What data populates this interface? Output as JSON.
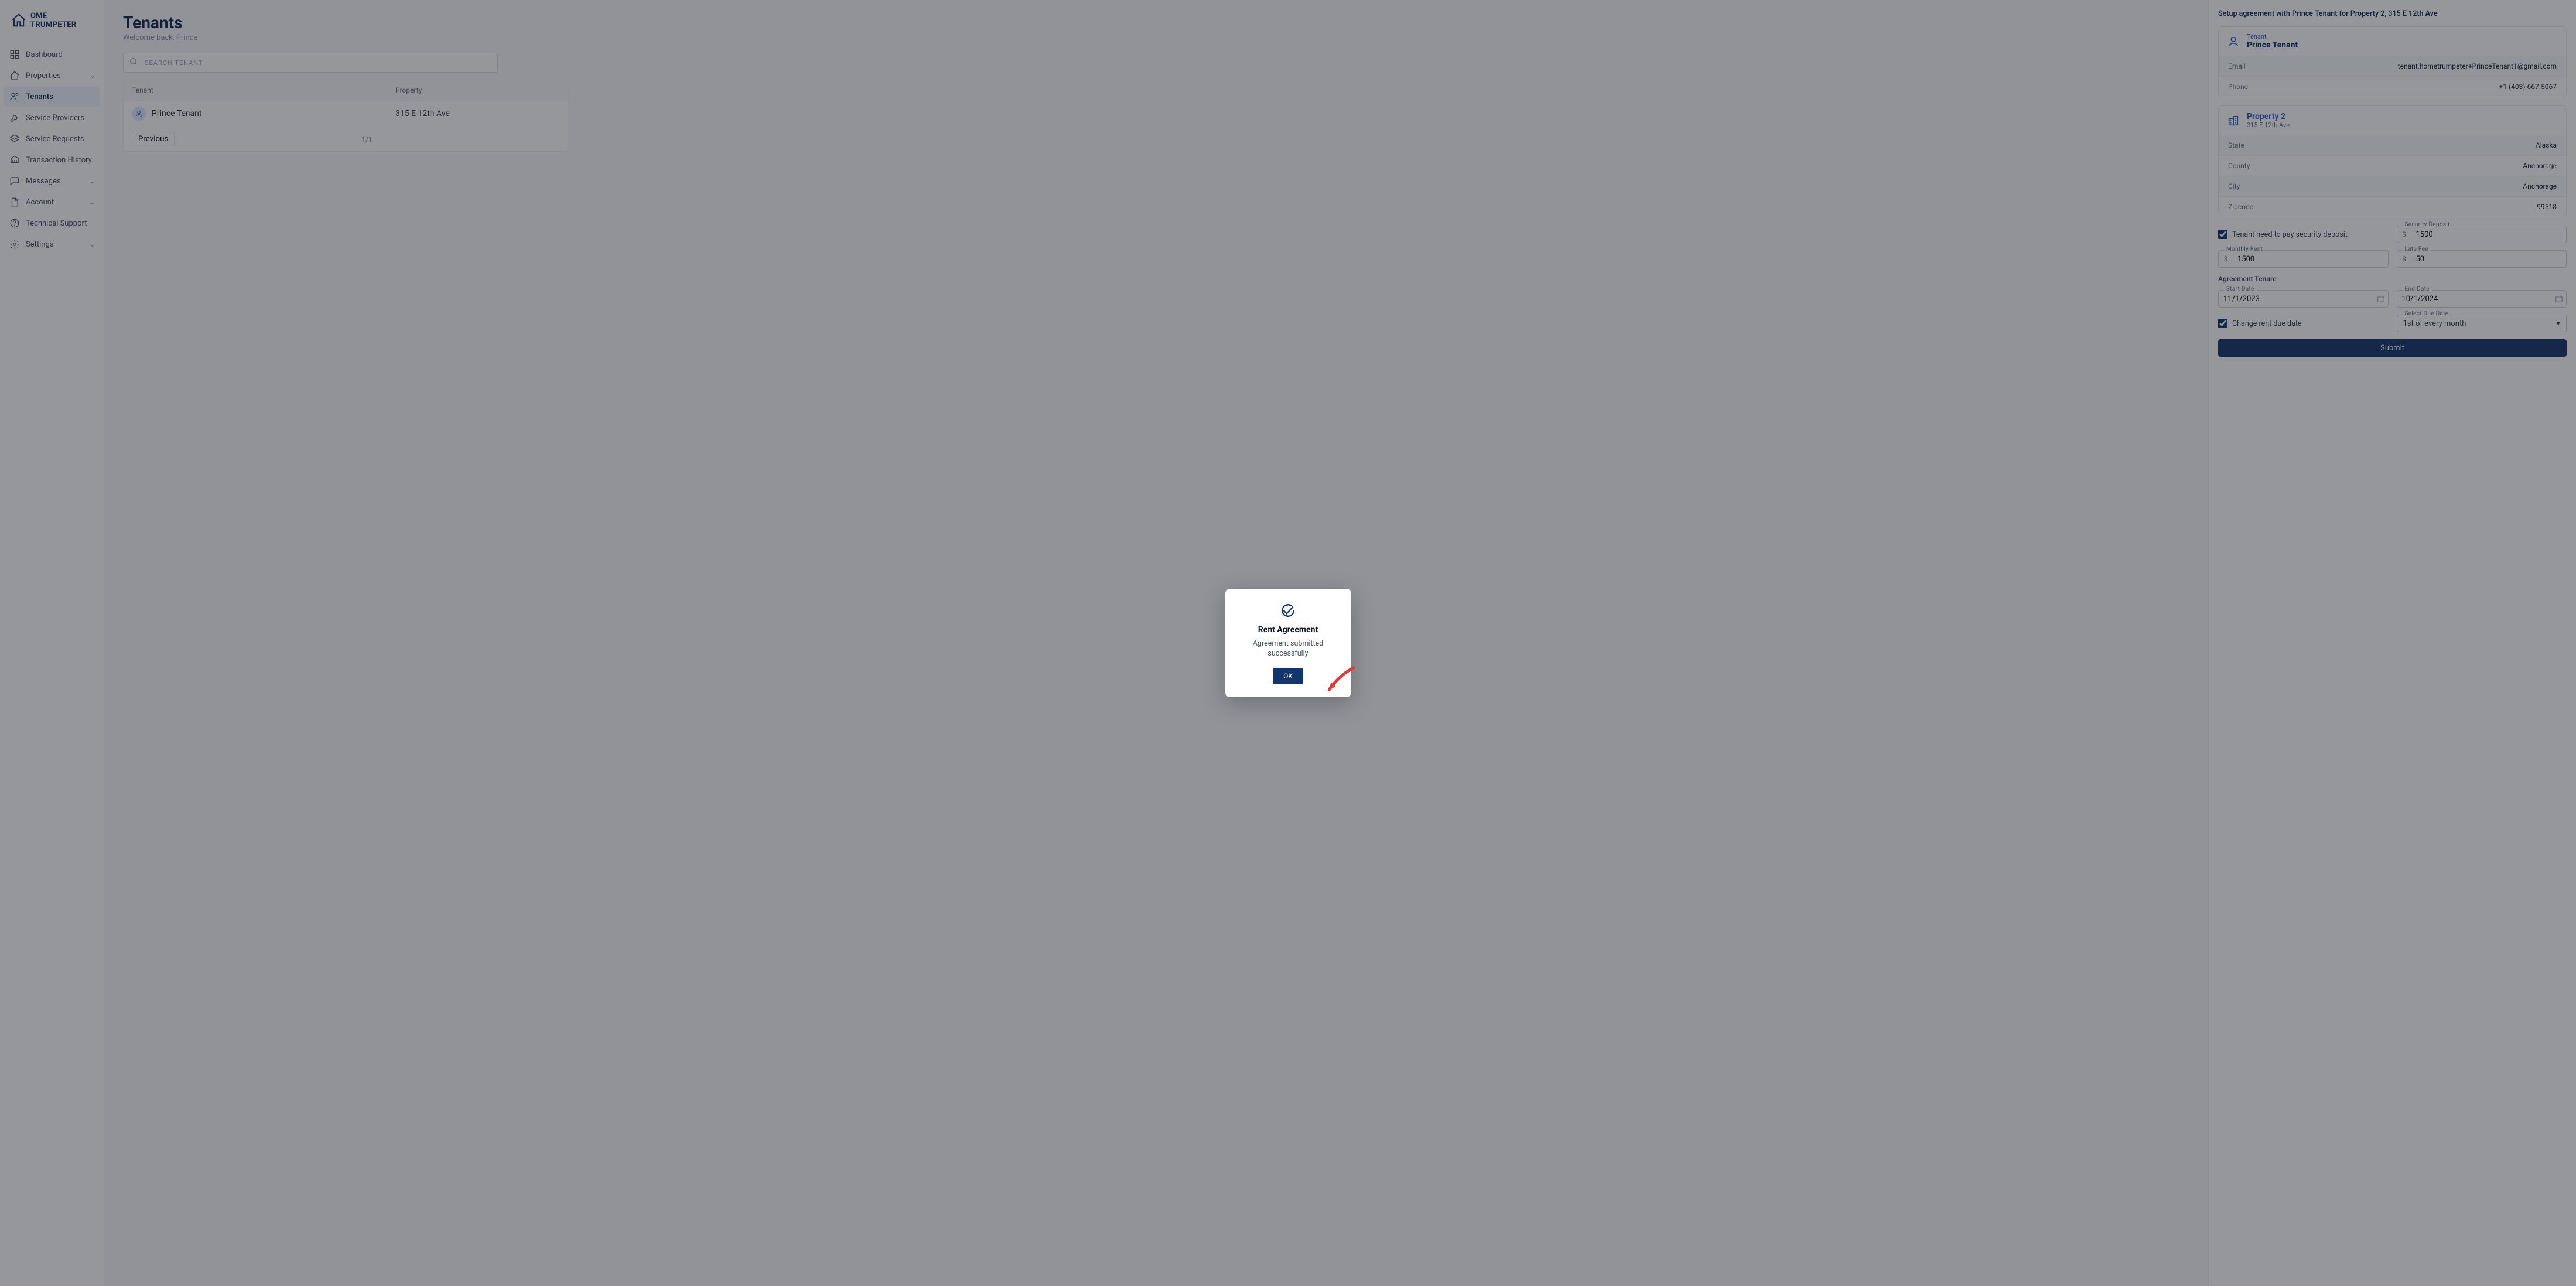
{
  "brand": "OME TRUMPETER",
  "sidebar": {
    "items": [
      {
        "label": "Dashboard",
        "icon": "layout-icon"
      },
      {
        "label": "Properties",
        "icon": "home-icon",
        "expandable": true
      },
      {
        "label": "Tenants",
        "icon": "users-icon",
        "active": true
      },
      {
        "label": "Service Providers",
        "icon": "wrench-icon"
      },
      {
        "label": "Service Requests",
        "icon": "layers-icon"
      },
      {
        "label": "Transaction History",
        "icon": "bank-icon"
      },
      {
        "label": "Messages",
        "icon": "message-icon",
        "expandable": true
      },
      {
        "label": "Account",
        "icon": "file-icon",
        "expandable": true
      },
      {
        "label": "Technical Support",
        "icon": "help-icon"
      },
      {
        "label": "Settings",
        "icon": "gear-icon",
        "expandable": true
      }
    ]
  },
  "main": {
    "title": "Tenants",
    "welcome": "Welcome back, Prince",
    "search_placeholder": "Search Tenant",
    "columns": {
      "tenant": "Tenant",
      "property": "Property"
    },
    "rows": [
      {
        "name": "Prince Tenant",
        "property": "315 E 12th Ave"
      }
    ],
    "footer": {
      "previous": "Previous",
      "page_info": "1/1"
    }
  },
  "panel": {
    "heading": "Setup agreement with Prince Tenant for Property 2, 315 E 12th Ave",
    "tenant_card": {
      "label": "Tenant",
      "name": "Prince Tenant",
      "rows": [
        {
          "k": "Email",
          "v": "tenant.hometrumpeter+PrinceTenant1@gmail.com"
        },
        {
          "k": "Phone",
          "v": "+1 (403) 667-5067"
        }
      ]
    },
    "property_card": {
      "label": "Property 2",
      "address": "315 E 12th Ave",
      "rows": [
        {
          "k": "State",
          "v": "Alaska"
        },
        {
          "k": "County",
          "v": "Anchorage"
        },
        {
          "k": "City",
          "v": "Anchorage"
        },
        {
          "k": "Zipcode",
          "v": "99518"
        }
      ]
    },
    "form": {
      "deposit_check_label": "Tenant need to pay security deposit",
      "deposit_checked": true,
      "security_deposit_label": "Security Deposit",
      "security_deposit": "1500",
      "monthly_rent_label": "Monthly Rent",
      "monthly_rent": "1500",
      "late_fee_label": "Late Fee",
      "late_fee": "50",
      "tenure_label": "Agreement Tenure",
      "start_date_label": "Start Date",
      "start_date": "11/1/2023",
      "end_date_label": "End Date",
      "end_date": "10/1/2024",
      "change_due_label": "Change rent due date",
      "change_due_checked": true,
      "due_date_label": "Select Due Date",
      "due_date_value": "1st of every month",
      "submit_label": "Submit"
    }
  },
  "modal": {
    "title": "Rent Agreement",
    "message": "Agreement submitted successfully",
    "ok": "OK"
  }
}
